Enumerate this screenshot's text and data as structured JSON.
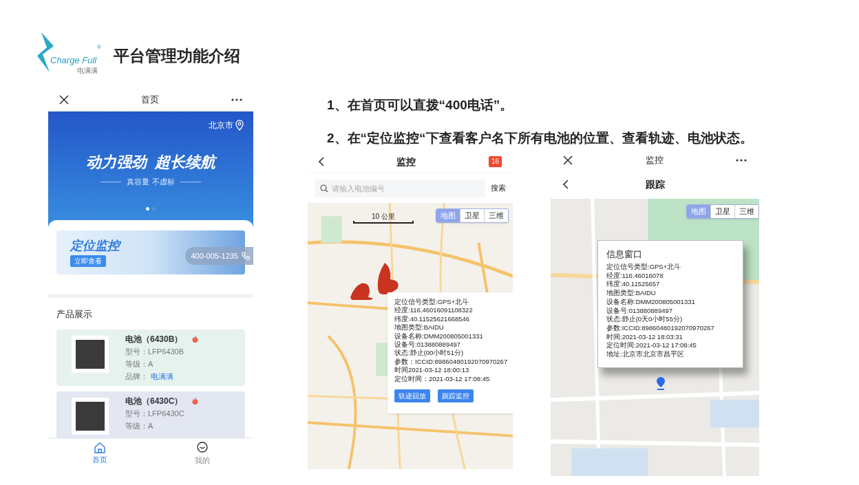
{
  "slide": {
    "title": "平台管理功能介绍",
    "logo": {
      "wordmark": "Charge Full",
      "subtitle": "电满满",
      "registered": "®"
    }
  },
  "notes": [
    "1、在首页可以直拨“400电话”。",
    "2、在“定位监控“下查看客户名下所有电池的位置、查看轨迹、电池状态。"
  ],
  "home_screen": {
    "title": "首页",
    "city": "北京市",
    "banner": {
      "headline": "动力强劲  超长续航",
      "tagline": "真容量 不虚标",
      "dots": [
        {
          "selected": true
        },
        {
          "selected": false
        }
      ]
    },
    "promo": {
      "title": "定位监控",
      "button": "立即查看",
      "hotline": "400-005-1235"
    },
    "section_title": "产品展示",
    "products": [
      {
        "name": "电池（6430B）",
        "hot": true,
        "color": "#e6f2ee",
        "fields": [
          {
            "label": "型号：",
            "value": "LFP6430B",
            "kind": "plain"
          },
          {
            "label": "等级：",
            "value": "A",
            "kind": "plain"
          },
          {
            "label": "品牌：",
            "value": "电满满",
            "kind": "link"
          }
        ]
      },
      {
        "name": "电池（6430C）",
        "hot": true,
        "color": "#e3e7f2",
        "fields": [
          {
            "label": "型号：",
            "value": "LFP6430C",
            "kind": "plain"
          },
          {
            "label": "等级：",
            "value": "A",
            "kind": "plain"
          }
        ]
      }
    ],
    "tabs": [
      {
        "label": "首页",
        "selected": true
      },
      {
        "label": "我的",
        "selected": false
      }
    ]
  },
  "monitor_screen": {
    "title": "监控",
    "badge": "16",
    "search": {
      "placeholder": "请输入电池编号",
      "button": "搜索"
    },
    "map": {
      "scale": "10 公里",
      "map_types": [
        {
          "label": "地图",
          "selected": true
        },
        {
          "label": "卫星",
          "selected": false
        },
        {
          "label": "三维",
          "selected": false
        }
      ],
      "info": {
        "lines": [
          "定位信号类型:GPS+北斗",
          "经度:116.46016091108322",
          "纬度:40.11525621668546",
          "地图类型:BAIDU",
          "设备名称:DMM200805001331",
          "设备号:013880889497",
          "状态:静止(00小时51分)",
          "参数：ICCID:89860480192070970267",
          "时间2021-03-12 18:00:13",
          "定位时间：2021-03-12 17:08:45"
        ],
        "buttons": [
          "轨迹回放",
          "跟踪监控"
        ]
      }
    }
  },
  "tracking_screen": {
    "title": "监控",
    "subtitle": "跟踪",
    "map": {
      "map_types": [
        {
          "label": "地图",
          "selected": true
        },
        {
          "label": "卫星",
          "selected": false
        },
        {
          "label": "三维",
          "selected": false
        }
      ],
      "info": {
        "title": "信息窗口",
        "lines": [
          "定位信号类型:GPS+北斗",
          "经度:116.46016078",
          "纬度:40.11525657",
          "地图类型:BAIDU",
          "设备名称:DMM200805001331",
          "设备号:013880889497",
          "状态:静止(0天0小时55分)",
          "参数:ICCID:89860480192070970267",
          "时间:2021-03-12 18:03:31",
          "定位时间:2021-03-12 17:08:45",
          "地址:北京市北京市昌平区"
        ]
      }
    }
  }
}
